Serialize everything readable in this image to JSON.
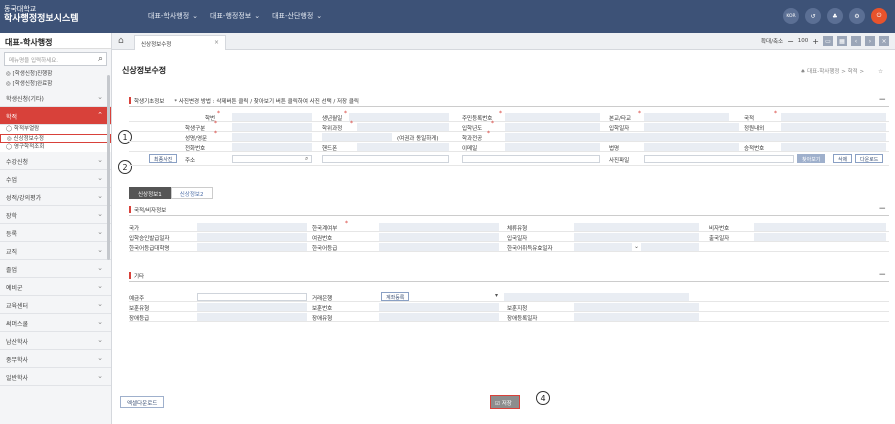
{
  "app": {
    "line1": "동국대학교",
    "line2": "학사행정정보시스템"
  },
  "topmenu": [
    {
      "label": "대표-학사행정"
    },
    {
      "label": "대표-행정정보"
    },
    {
      "label": "대표-산단행정"
    }
  ],
  "topicons": {
    "lang": "KOR",
    "share": "↺",
    "org": "♣",
    "settings": "⚙",
    "power": "⏻"
  },
  "sidebar": {
    "title": "대표-학사행정",
    "search_placeholder": "메뉴명을 입력하세요.",
    "favorites": [
      "◎ [학생신청]진행함",
      "◎ [학생신청]완료함"
    ],
    "groups_top": [
      "학생신청(기타)"
    ],
    "active_group": "학적",
    "subitems": [
      "◯ 학적부열람",
      "◎ 신상정보수정",
      "◯ 영구학적조회"
    ],
    "groups": [
      "수강신청",
      "수업",
      "성적/강의평가",
      "장학",
      "등록",
      "교직",
      "졸업",
      "예비군",
      "교육센터",
      "써머스쿨",
      "남산학사",
      "중무학사",
      "일반학사"
    ]
  },
  "annotations": {
    "a1": "1",
    "a2": "2",
    "a4": "4"
  },
  "tabbar": {
    "tab_label": "신상정보수정",
    "zoom_label": "확대/축소",
    "zoom_value": "100"
  },
  "page": {
    "title": "신상정보수정",
    "breadcrumb": "대표-학사행정 > 학적 >"
  },
  "sect1": {
    "title": "학생기초정보",
    "note": "* 사진변경 방법 : 삭제버튼 클릭 / 찾아보기 버튼 클릭하여 사진 선택 / 저장 클릭"
  },
  "basic": {
    "r1": [
      "학번",
      "생년월일",
      "주민등록번호",
      "본교/타교",
      "국적"
    ],
    "r2": [
      "학생구분",
      "학위과정",
      "입학년도",
      "입학일자",
      "정원내외"
    ],
    "r3": [
      "성명/영문",
      "(여권과 동일하게)",
      "학과전공"
    ],
    "r4": [
      "전화번호",
      "핸드폰",
      "이메일",
      "법명",
      "승적번호"
    ],
    "r5": [
      "주소",
      "사진파일"
    ],
    "photo_btn": "최종사진",
    "browse": "찾아보기",
    "delete": "삭제",
    "download": "다운로드"
  },
  "subtabs": [
    "신상정보1",
    "신상정보2"
  ],
  "sect2": {
    "title": "국적/비자정보"
  },
  "visa": {
    "r1": [
      "국가",
      "한국계여부",
      "체류유형",
      "비자번호"
    ],
    "r2": [
      "입학승인발급일자",
      "여권번호",
      "입국일자",
      "출국일자"
    ],
    "r3": [
      "한국어등급대학명",
      "한국어등급",
      "한국어취득유효일자"
    ]
  },
  "sect3": {
    "title": "기타"
  },
  "etc": {
    "r1": [
      "예금주",
      "거래은행",
      "계좌등록"
    ],
    "r2": [
      "보훈유형",
      "보훈번호",
      "보훈지청"
    ],
    "r3": [
      "장애등급",
      "장애유형",
      "장애등록일자"
    ]
  },
  "footer": {
    "excel": "엑셀다운로드",
    "save": "저장"
  }
}
